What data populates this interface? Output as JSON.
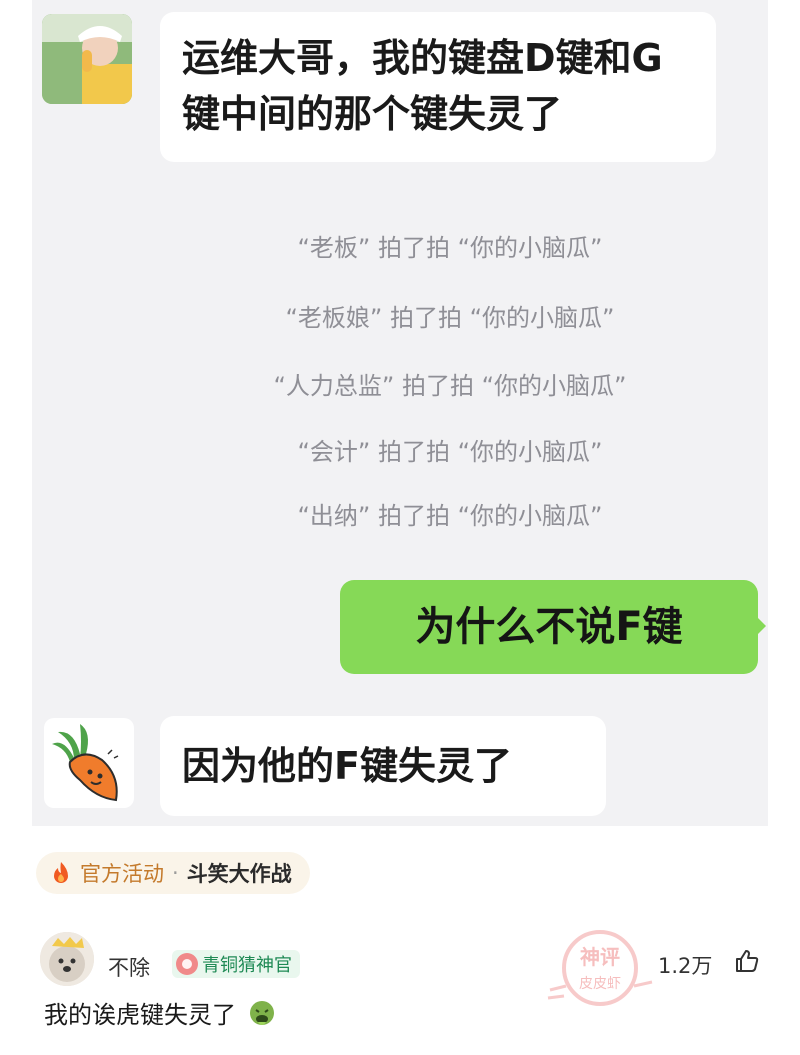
{
  "chat": {
    "message_top": "运维大哥，我的键盘D键和G键中间的那个键失灵了",
    "notices": [
      "“老板” 拍了拍 “你的小脑瓜”",
      "“老板娘” 拍了拍 “你的小脑瓜”",
      "“人力总监” 拍了拍 “你的小脑瓜”",
      "“会计” 拍了拍 “你的小脑瓜”",
      "“出纳” 拍了拍 “你的小脑瓜”"
    ],
    "message_green": "为什么不说F键",
    "message_bottom": "因为他的F键失灵了"
  },
  "topic": {
    "label": "官方活动",
    "separator": "·",
    "name": "斗笑大作战"
  },
  "comment": {
    "username": "不除",
    "badge": "青铜猜神官",
    "text": "我的诶虎键失灵了",
    "likes": "1.2万",
    "stamp_text": [
      "神评",
      "皮皮虾"
    ]
  },
  "colors": {
    "chat_bg": "#f2f2f4",
    "green_bubble": "#86d957",
    "notice_text": "#8f8f96",
    "topic_accent": "#c47a2c",
    "badge_green": "#1f8a55"
  }
}
